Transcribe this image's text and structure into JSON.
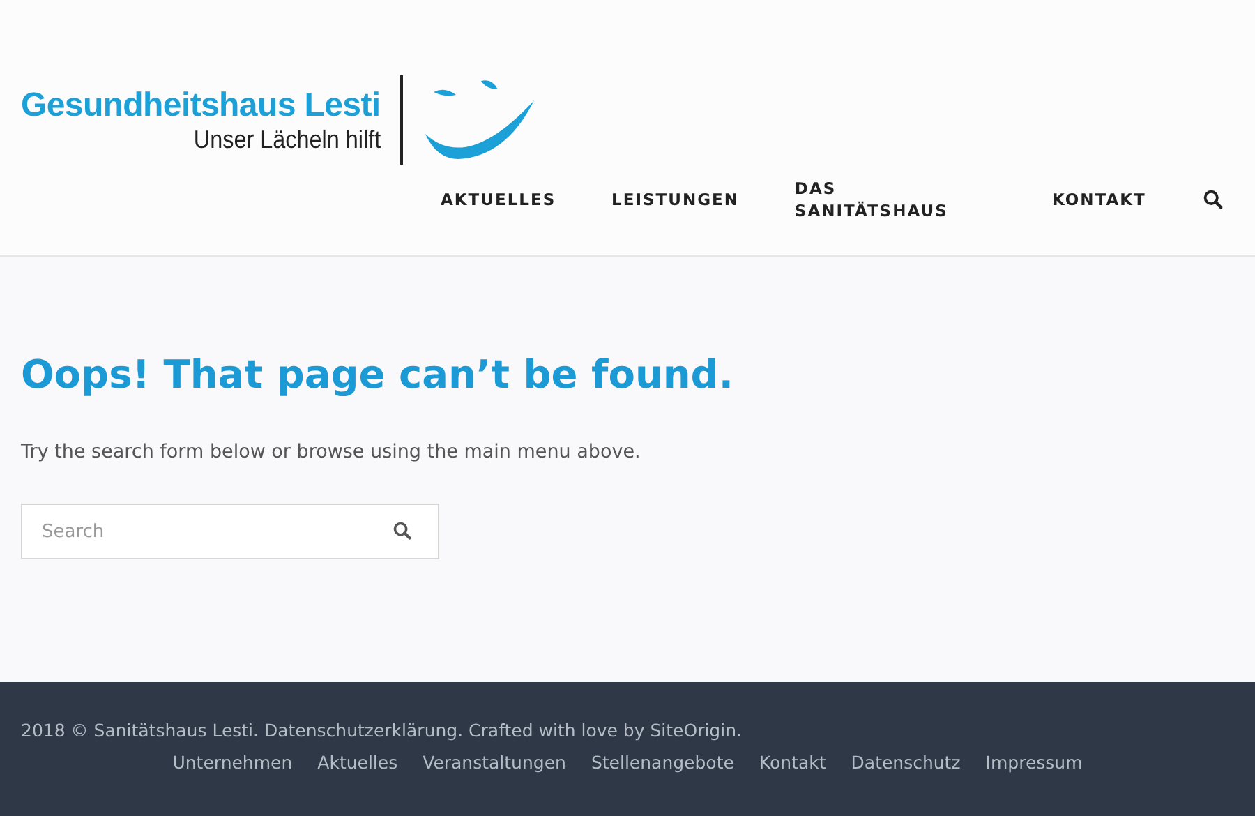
{
  "header": {
    "logo": {
      "name": "Gesundheitshaus Lesti",
      "tagline": "Unser Lächeln hilft"
    },
    "nav": [
      {
        "label": "AKTUELLES"
      },
      {
        "label": "LEISTUNGEN"
      },
      {
        "label": "DAS SANITÄTSHAUS"
      },
      {
        "label": "KONTAKT"
      }
    ]
  },
  "main": {
    "title": "Oops! That page can’t be found.",
    "text": "Try the search form below or browse using the main menu above.",
    "search": {
      "placeholder": "Search"
    }
  },
  "footer": {
    "credit": "2018 © Sanitätshaus Lesti. Datenschutzerklärung. Crafted with love by SiteOrigin.",
    "links": [
      "Unternehmen",
      "Aktuelles",
      "Veranstaltungen",
      "Stellenangebote",
      "Kontakt",
      "Datenschutz",
      "Impressum"
    ]
  }
}
